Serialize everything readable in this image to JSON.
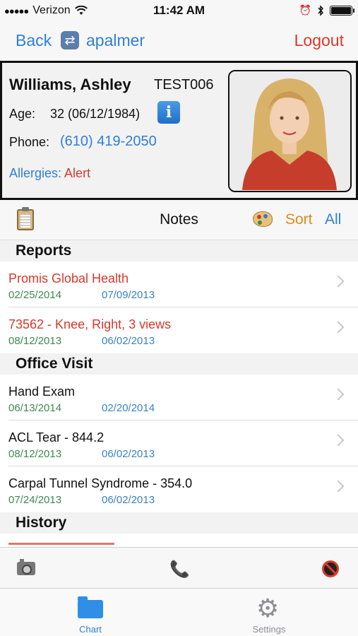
{
  "status_bar": {
    "carrier": "Verizon",
    "time": "11:42 AM",
    "signal_icon": "signal-dots-icon",
    "wifi_icon": "wifi-icon",
    "alarm_icon": "alarm-clock-icon",
    "bluetooth_icon": "bluetooth-icon",
    "battery_icon": "battery-icon",
    "battery_level": 1.0
  },
  "nav": {
    "back_label": "Back",
    "sync_icon": "sync-icon",
    "username": "apalmer",
    "logout_label": "Logout"
  },
  "patient": {
    "name": "Williams, Ashley",
    "id": "TEST006",
    "age_label": "Age:",
    "age_value": "32 (06/12/1984)",
    "info_icon": "info-icon",
    "phone_label": "Phone:",
    "phone_value": "(610) 419-2050",
    "allergies_label": "Allergies:",
    "allergies_value": "Alert"
  },
  "notes_bar": {
    "clipboard_icon": "clipboard-icon",
    "title": "Notes",
    "palette_icon": "palette-icon",
    "sort_label": "Sort",
    "filter_label": "All"
  },
  "sections": [
    {
      "header": "Reports",
      "rows": [
        {
          "title": "Promis Global Health",
          "date1": "02/25/2014",
          "date2": "07/09/2013",
          "title_color": "red"
        },
        {
          "title": "73562 - Knee, Right, 3 views",
          "date1": "08/12/2013",
          "date2": "06/02/2013",
          "title_color": "red"
        }
      ]
    },
    {
      "header": "Office Visit",
      "rows": [
        {
          "title": "Hand Exam",
          "date1": "06/13/2014",
          "date2": "02/20/2014",
          "title_color": "black"
        },
        {
          "title": "ACL Tear - 844.2",
          "date1": "08/12/2013",
          "date2": "06/02/2013",
          "title_color": "black"
        },
        {
          "title": "Carpal Tunnel Syndrome - 354.0",
          "date1": "07/24/2013",
          "date2": "06/02/2013",
          "title_color": "black"
        }
      ]
    },
    {
      "header": "History",
      "rows": []
    }
  ],
  "toolbar": {
    "camera_icon": "camera-icon",
    "phone_icon": "phone-icon",
    "no_entry_icon": "no-entry-icon"
  },
  "tabs": [
    {
      "label": "Chart",
      "icon": "folder-icon",
      "selected": true
    },
    {
      "label": "Settings",
      "icon": "gear-icon",
      "selected": false
    }
  ],
  "colors": {
    "link_blue": "#2f7fd6",
    "alert_red": "#d6392b",
    "sort_orange": "#e08a1e",
    "date_green": "#3f8a4f",
    "date_blue": "#3b82c4"
  }
}
